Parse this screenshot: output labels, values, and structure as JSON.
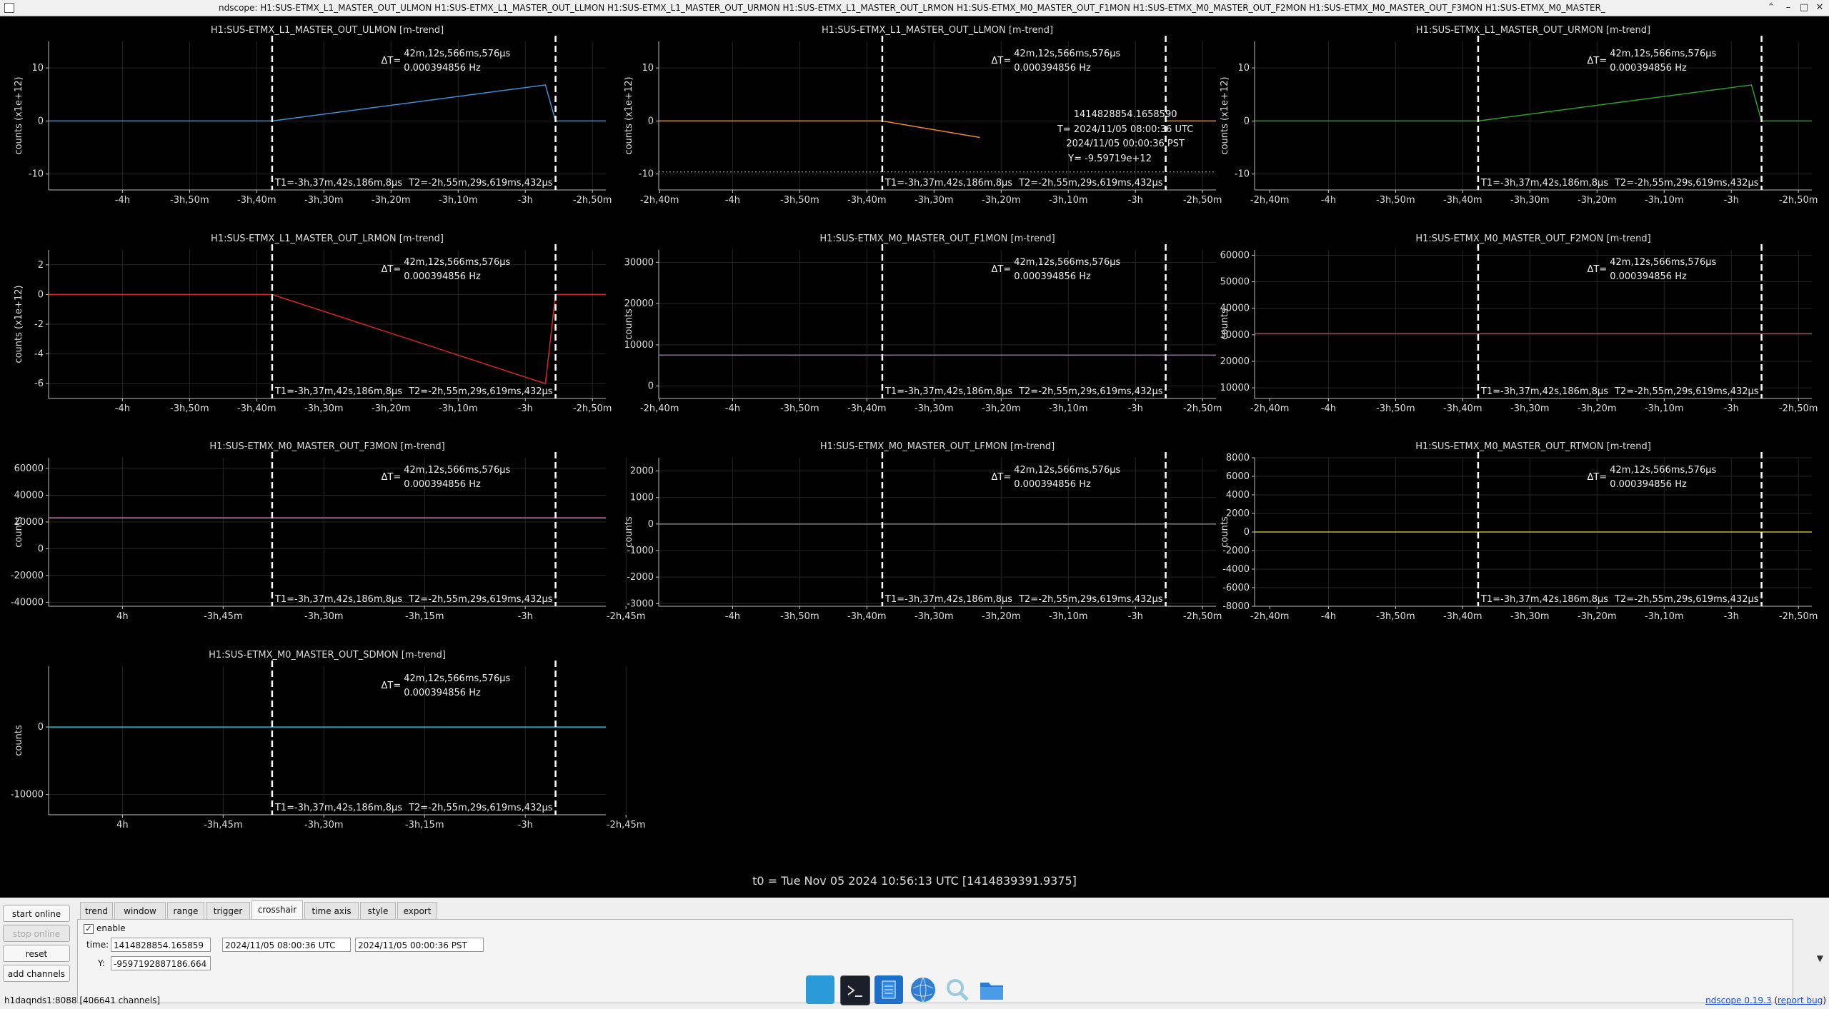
{
  "window": {
    "title": "ndscope: H1:SUS-ETMX_L1_MASTER_OUT_ULMON H1:SUS-ETMX_L1_MASTER_OUT_LLMON H1:SUS-ETMX_L1_MASTER_OUT_URMON H1:SUS-ETMX_L1_MASTER_OUT_LRMON H1:SUS-ETMX_M0_MASTER_OUT_F1MON H1:SUS-ETMX_M0_MASTER_OUT_F2MON H1:SUS-ETMX_M0_MASTER_OUT_F3MON H1:SUS-ETMX_M0_MASTER_",
    "controls": [
      "⌃",
      "–",
      "□",
      "✕"
    ]
  },
  "cursor": {
    "delta_label": "ΔT=",
    "delta_time": "42m,12s,566ms,576μs",
    "delta_freq": "0.000394856 Hz",
    "t1": "T1=-3h,37m,42s,186m,8μs",
    "t2": "T2=-2h,55m,29s,619ms,432μs",
    "t1_range_x": -13062.186,
    "t2_range_x": -10529.619
  },
  "crosshair_readout": {
    "gps": "1414828854.1658590",
    "utc": "T= 2024/11/05 08:00:36 UTC",
    "pst": "2024/11/05 00:00:36 PST",
    "y": "Y= -9.59719e+12"
  },
  "t0_text": "t0 = Tue Nov 05 2024 10:56:13 UTC [1414839391.9375]",
  "chart_data": [
    {
      "type": "line",
      "title": "H1:SUS-ETMX_L1_MASTER_OUT_ULMON [m-trend]",
      "ylabel": "counts (x1e+12)",
      "ylim": [
        -13,
        15
      ],
      "xlim": [
        -15060,
        -10080
      ],
      "xticks": [
        {
          "v": -14400,
          "l": "-4h"
        },
        {
          "v": -13800,
          "l": "-3h,50m"
        },
        {
          "v": -13200,
          "l": "-3h,40m"
        },
        {
          "v": -12600,
          "l": "-3h,30m"
        },
        {
          "v": -12000,
          "l": "-3h,20m"
        },
        {
          "v": -11400,
          "l": "-3h,10m"
        },
        {
          "v": -10800,
          "l": "-3h"
        },
        {
          "v": -10200,
          "l": "-2h,50m"
        },
        {
          "v": -9600,
          "l": "-2h,40m"
        }
      ],
      "yticks": [
        {
          "v": 10,
          "l": "10"
        },
        {
          "v": 0,
          "l": "0"
        },
        {
          "v": -10,
          "l": "-10"
        }
      ],
      "series": [
        {
          "color": "#3f8fd8",
          "points": [
            [
              -15060,
              0
            ],
            [
              -13062,
              0
            ],
            [
              -10620,
              6.8
            ],
            [
              -10530,
              0
            ],
            [
              -10080,
              0
            ]
          ]
        }
      ]
    },
    {
      "type": "line",
      "title": "H1:SUS-ETMX_L1_MASTER_OUT_LLMON [m-trend]",
      "ylabel": "counts (x1e+12)",
      "ylim": [
        -13,
        15
      ],
      "xlim": [
        -15060,
        -10080
      ],
      "xticks": [
        {
          "v": -14400,
          "l": "-4h"
        },
        {
          "v": -13800,
          "l": "-3h,50m"
        },
        {
          "v": -13200,
          "l": "-3h,40m"
        },
        {
          "v": -12600,
          "l": "-3h,30m"
        },
        {
          "v": -12000,
          "l": "-3h,20m"
        },
        {
          "v": -11400,
          "l": "-3h,10m"
        },
        {
          "v": -10800,
          "l": "-3h"
        },
        {
          "v": -10200,
          "l": "-2h,50m"
        },
        {
          "v": -9600,
          "l": "-2h,40m"
        }
      ],
      "yticks": [
        {
          "v": 10,
          "l": "10"
        },
        {
          "v": 0,
          "l": "0"
        },
        {
          "v": -10,
          "l": "-10"
        }
      ],
      "hline": -9.6,
      "series": [
        {
          "color": "#f08a24",
          "points": [
            [
              -15060,
              0
            ],
            [
              -13062,
              0
            ],
            [
              -12190,
              -3.1
            ]
          ]
        },
        {
          "color": "#f08a24",
          "points": [
            [
              -10530,
              0
            ],
            [
              -10080,
              0
            ]
          ]
        }
      ]
    },
    {
      "type": "line",
      "title": "H1:SUS-ETMX_L1_MASTER_OUT_URMON [m-trend]",
      "ylabel": "counts (x1e+12)",
      "ylim": [
        -13,
        15
      ],
      "xlim": [
        -15060,
        -10080
      ],
      "xticks": [
        {
          "v": -14400,
          "l": "-4h"
        },
        {
          "v": -13800,
          "l": "-3h,50m"
        },
        {
          "v": -13200,
          "l": "-3h,40m"
        },
        {
          "v": -12600,
          "l": "-3h,30m"
        },
        {
          "v": -12000,
          "l": "-3h,20m"
        },
        {
          "v": -11400,
          "l": "-3h,10m"
        },
        {
          "v": -10800,
          "l": "-3h"
        },
        {
          "v": -10200,
          "l": "-2h,50m"
        },
        {
          "v": -9600,
          "l": "-2h,40m"
        }
      ],
      "yticks": [
        {
          "v": 10,
          "l": "10"
        },
        {
          "v": 0,
          "l": "0"
        },
        {
          "v": -10,
          "l": "-10"
        }
      ],
      "series": [
        {
          "color": "#2ca02c",
          "points": [
            [
              -15060,
              0
            ],
            [
              -13062,
              0
            ],
            [
              -10620,
              6.8
            ],
            [
              -10530,
              0
            ],
            [
              -10080,
              0
            ]
          ]
        }
      ]
    },
    {
      "type": "line",
      "title": "H1:SUS-ETMX_L1_MASTER_OUT_LRMON [m-trend]",
      "ylabel": "counts (x1e+12)",
      "ylim": [
        -7,
        3
      ],
      "xlim": [
        -15060,
        -10080
      ],
      "xticks": [
        {
          "v": -14400,
          "l": "-4h"
        },
        {
          "v": -13800,
          "l": "-3h,50m"
        },
        {
          "v": -13200,
          "l": "-3h,40m"
        },
        {
          "v": -12600,
          "l": "-3h,30m"
        },
        {
          "v": -12000,
          "l": "-3h,20m"
        },
        {
          "v": -11400,
          "l": "-3h,10m"
        },
        {
          "v": -10800,
          "l": "-3h"
        },
        {
          "v": -10200,
          "l": "-2h,50m"
        },
        {
          "v": -9600,
          "l": "-2h,40m"
        }
      ],
      "yticks": [
        {
          "v": 2,
          "l": "2"
        },
        {
          "v": 0,
          "l": "0"
        },
        {
          "v": -2,
          "l": "-2"
        },
        {
          "v": -4,
          "l": "-4"
        },
        {
          "v": -6,
          "l": "-6"
        }
      ],
      "series": [
        {
          "color": "#d62728",
          "points": [
            [
              -15060,
              0
            ],
            [
              -13062,
              0
            ],
            [
              -10620,
              -6.0
            ],
            [
              -10530,
              0
            ],
            [
              -10080,
              0
            ]
          ]
        }
      ]
    },
    {
      "type": "line",
      "title": "H1:SUS-ETMX_M0_MASTER_OUT_F1MON [m-trend]",
      "ylabel": "counts",
      "ylim": [
        -3000,
        33000
      ],
      "xlim": [
        -15060,
        -10080
      ],
      "xticks": [
        {
          "v": -14400,
          "l": "-4h"
        },
        {
          "v": -13800,
          "l": "-3h,50m"
        },
        {
          "v": -13200,
          "l": "-3h,40m"
        },
        {
          "v": -12600,
          "l": "-3h,30m"
        },
        {
          "v": -12000,
          "l": "-3h,20m"
        },
        {
          "v": -11400,
          "l": "-3h,10m"
        },
        {
          "v": -10800,
          "l": "-3h"
        },
        {
          "v": -10200,
          "l": "-2h,50m"
        },
        {
          "v": -9600,
          "l": "-2h,40m"
        }
      ],
      "yticks": [
        {
          "v": 30000,
          "l": "30000"
        },
        {
          "v": 20000,
          "l": "20000"
        },
        {
          "v": 10000,
          "l": "10000"
        },
        {
          "v": 0,
          "l": "0"
        }
      ],
      "series": [
        {
          "color": "#9467bd",
          "points": [
            [
              -15060,
              7500
            ],
            [
              -10080,
              7500
            ]
          ]
        }
      ]
    },
    {
      "type": "line",
      "title": "H1:SUS-ETMX_M0_MASTER_OUT_F2MON [m-trend]",
      "ylabel": "counts",
      "ylim": [
        6000,
        62000
      ],
      "xlim": [
        -15060,
        -10080
      ],
      "xticks": [
        {
          "v": -14400,
          "l": "-4h"
        },
        {
          "v": -13800,
          "l": "-3h,50m"
        },
        {
          "v": -13200,
          "l": "-3h,40m"
        },
        {
          "v": -12600,
          "l": "-3h,30m"
        },
        {
          "v": -12000,
          "l": "-3h,20m"
        },
        {
          "v": -11400,
          "l": "-3h,10m"
        },
        {
          "v": -10800,
          "l": "-3h"
        },
        {
          "v": -10200,
          "l": "-2h,50m"
        },
        {
          "v": -9600,
          "l": "-2h,40m"
        }
      ],
      "yticks": [
        {
          "v": 60000,
          "l": "60000"
        },
        {
          "v": 50000,
          "l": "50000"
        },
        {
          "v": 40000,
          "l": "40000"
        },
        {
          "v": 30000,
          "l": "30000"
        },
        {
          "v": 20000,
          "l": "20000"
        },
        {
          "v": 10000,
          "l": "10000"
        }
      ],
      "series": [
        {
          "color": "#8c564b",
          "points": [
            [
              -15060,
              30500
            ],
            [
              -10080,
              30500
            ]
          ]
        }
      ]
    },
    {
      "type": "line",
      "title": "H1:SUS-ETMX_M0_MASTER_OUT_F3MON [m-trend]",
      "ylabel": "counts",
      "ylim": [
        -43000,
        68000
      ],
      "xlim": [
        -15060,
        -10080
      ],
      "xticks": [
        {
          "v": -14400,
          "l": "4h"
        },
        {
          "v": -13500,
          "l": "-3h,45m"
        },
        {
          "v": -12600,
          "l": "-3h,30m"
        },
        {
          "v": -11700,
          "l": "-3h,15m"
        },
        {
          "v": -10800,
          "l": "-3h"
        },
        {
          "v": -9900,
          "l": "-2h,45m"
        }
      ],
      "yticks": [
        {
          "v": 60000,
          "l": "60000"
        },
        {
          "v": 40000,
          "l": "40000"
        },
        {
          "v": 20000,
          "l": "20000"
        },
        {
          "v": 0,
          "l": "0"
        },
        {
          "v": -20000,
          "l": "-20000"
        },
        {
          "v": -40000,
          "l": "-40000"
        }
      ],
      "series": [
        {
          "color": "#e377c2",
          "points": [
            [
              -15060,
              23000
            ],
            [
              -10080,
              23000
            ]
          ]
        }
      ]
    },
    {
      "type": "line",
      "title": "H1:SUS-ETMX_M0_MASTER_OUT_LFMON [m-trend]",
      "ylabel": "counts",
      "ylim": [
        -3100,
        2500
      ],
      "xlim": [
        -15060,
        -10080
      ],
      "xticks": [
        {
          "v": -14400,
          "l": "-4h"
        },
        {
          "v": -13800,
          "l": "-3h,50m"
        },
        {
          "v": -13200,
          "l": "-3h,40m"
        },
        {
          "v": -12600,
          "l": "-3h,30m"
        },
        {
          "v": -12000,
          "l": "-3h,20m"
        },
        {
          "v": -11400,
          "l": "-3h,10m"
        },
        {
          "v": -10800,
          "l": "-3h"
        },
        {
          "v": -10200,
          "l": "-2h,50m"
        },
        {
          "v": -9600,
          "l": "-2h,40m"
        }
      ],
      "yticks": [
        {
          "v": 2000,
          "l": "2000"
        },
        {
          "v": 1000,
          "l": "1000"
        },
        {
          "v": 0,
          "l": "0"
        },
        {
          "v": -1000,
          "l": "-1000"
        },
        {
          "v": -2000,
          "l": "-2000"
        },
        {
          "v": -3000,
          "l": "-3000"
        }
      ],
      "series": [
        {
          "color": "#7f7f7f",
          "points": [
            [
              -15060,
              0
            ],
            [
              -10080,
              0
            ]
          ]
        }
      ]
    },
    {
      "type": "line",
      "title": "H1:SUS-ETMX_M0_MASTER_OUT_RTMON [m-trend]",
      "ylabel": "counts",
      "ylim": [
        -8000,
        8000
      ],
      "xlim": [
        -15060,
        -10080
      ],
      "xticks": [
        {
          "v": -14400,
          "l": "-4h"
        },
        {
          "v": -13800,
          "l": "-3h,50m"
        },
        {
          "v": -13200,
          "l": "-3h,40m"
        },
        {
          "v": -12600,
          "l": "-3h,30m"
        },
        {
          "v": -12000,
          "l": "-3h,20m"
        },
        {
          "v": -11400,
          "l": "-3h,10m"
        },
        {
          "v": -10800,
          "l": "-3h"
        },
        {
          "v": -10200,
          "l": "-2h,50m"
        },
        {
          "v": -9600,
          "l": "-2h,40m"
        }
      ],
      "yticks": [
        {
          "v": 8000,
          "l": "8000"
        },
        {
          "v": 6000,
          "l": "6000"
        },
        {
          "v": 4000,
          "l": "4000"
        },
        {
          "v": 2000,
          "l": "2000"
        },
        {
          "v": 0,
          "l": "0"
        },
        {
          "v": -2000,
          "l": "-2000"
        },
        {
          "v": -4000,
          "l": "-4000"
        },
        {
          "v": -6000,
          "l": "-6000"
        },
        {
          "v": -8000,
          "l": "-8000"
        }
      ],
      "series": [
        {
          "color": "#bcbd22",
          "points": [
            [
              -15060,
              0
            ],
            [
              -10080,
              0
            ]
          ]
        }
      ]
    },
    {
      "type": "line",
      "title": "H1:SUS-ETMX_M0_MASTER_OUT_SDMON [m-trend]",
      "ylabel": "counts",
      "ylim": [
        -13000,
        9000
      ],
      "xlim": [
        -15060,
        -10080
      ],
      "xticks": [
        {
          "v": -14400,
          "l": "4h"
        },
        {
          "v": -13500,
          "l": "-3h,45m"
        },
        {
          "v": -12600,
          "l": "-3h,30m"
        },
        {
          "v": -11700,
          "l": "-3h,15m"
        },
        {
          "v": -10800,
          "l": "-3h"
        },
        {
          "v": -9900,
          "l": "-2h,45m"
        }
      ],
      "yticks": [
        {
          "v": 0,
          "l": "0"
        },
        {
          "v": -10000,
          "l": "-10000"
        }
      ],
      "series": [
        {
          "color": "#17becf",
          "points": [
            [
              -15060,
              0
            ],
            [
              -10080,
              0
            ]
          ]
        }
      ]
    }
  ],
  "panel": {
    "left_buttons": [
      {
        "label": "start online",
        "enabled": true
      },
      {
        "label": "stop online",
        "enabled": false
      },
      {
        "label": "reset",
        "enabled": true
      },
      {
        "label": "add channels",
        "enabled": true
      }
    ],
    "tabs": [
      "trend",
      "window",
      "range",
      "trigger",
      "crosshair",
      "time axis",
      "style",
      "export"
    ],
    "active_tab": "crosshair",
    "crosshair": {
      "enable_label": "enable",
      "enable_checked": true,
      "time_label": "time:",
      "time_gps": "1414828854.165859",
      "time_utc": "2024/11/05 08:00:36 UTC",
      "time_pst": "2024/11/05 00:00:36 PST",
      "y_label": "Y:",
      "y_value": "-9597192887186.664"
    },
    "status_text": "h1daqnds1:8088  [406641 channels]",
    "version_link": "ndscope 0.19.3",
    "report_link": "report bug"
  },
  "taskbar": [
    "desktop-icon",
    "terminal-icon",
    "text-editor-icon",
    "web-browser-icon",
    "search-icon",
    "file-manager-icon"
  ]
}
